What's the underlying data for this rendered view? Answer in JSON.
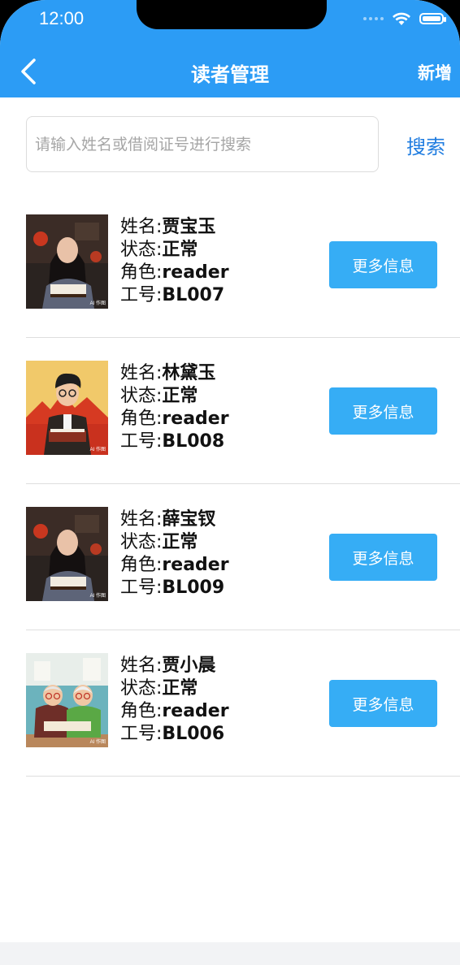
{
  "status_bar": {
    "time": "12:00"
  },
  "header": {
    "title": "读者管理",
    "add_label": "新增",
    "background": "#2c9cf5"
  },
  "search": {
    "placeholder": "请输入姓名或借阅证号进行搜索",
    "value": "",
    "button_label": "搜索"
  },
  "labels": {
    "name": "姓名:",
    "status": "状态:",
    "role": "角色:",
    "id": "工号:"
  },
  "more_button_color": "#36adf5",
  "readers": [
    {
      "name": "贾宝玉",
      "status": "正常",
      "role": "reader",
      "id": "BL007",
      "more": "更多信息",
      "avatar_badge": "AI 作图",
      "avatar": "girl-portrait"
    },
    {
      "name": "林黛玉",
      "status": "正常",
      "role": "reader",
      "id": "BL008",
      "more": "更多信息",
      "avatar_badge": "AI 作图",
      "avatar": "boy-cartoon"
    },
    {
      "name": "薛宝钗",
      "status": "正常",
      "role": "reader",
      "id": "BL009",
      "more": "更多信息",
      "avatar_badge": "AI 作图",
      "avatar": "girl-portrait"
    },
    {
      "name": "贾小晨",
      "status": "正常",
      "role": "reader",
      "id": "BL006",
      "more": "更多信息",
      "avatar_badge": "AI 作图",
      "avatar": "grandparents-cartoon"
    }
  ]
}
